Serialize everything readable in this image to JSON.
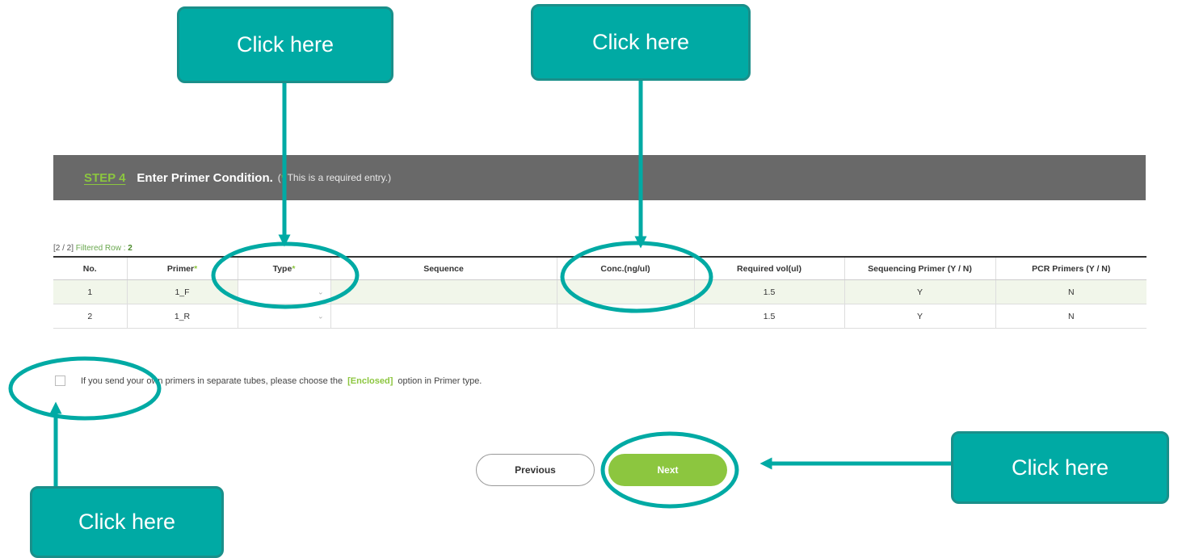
{
  "step": {
    "label": "STEP 4",
    "title": "Enter Primer Condition.",
    "note_star": "*",
    "note_text": " This is a required entry.)",
    "note_open": "("
  },
  "filter": {
    "range": "[2 / 2]",
    "label": " Filtered Row : ",
    "count": "2"
  },
  "table": {
    "headers": {
      "no": "No.",
      "primer": "Primer",
      "type": "Type",
      "sequence": "Sequence",
      "conc": "Conc.(ng/ul)",
      "required_vol": "Required vol(ul)",
      "sequencing": "Sequencing Primer (Y / N)",
      "pcr": "PCR Primers (Y / N)"
    },
    "required_mark": "*",
    "rows": [
      {
        "no": "1",
        "primer": "1_F",
        "type": "",
        "sequence": "",
        "conc": "",
        "required_vol": "1.5",
        "sequencing": "Y",
        "pcr": "N"
      },
      {
        "no": "2",
        "primer": "1_R",
        "type": "",
        "sequence": "",
        "conc": "",
        "required_vol": "1.5",
        "sequencing": "Y",
        "pcr": "N"
      }
    ]
  },
  "checkbox": {
    "text_before": "If you send your own primers in separate tubes, please choose the ",
    "highlight": "[Enclosed]",
    "text_after": " option in Primer type.",
    "checked": false
  },
  "buttons": {
    "previous": "Previous",
    "next": "Next"
  },
  "callouts": {
    "type_column": "Click here",
    "conc_column": "Click here",
    "next_button": "Click here",
    "checkbox": "Click here"
  },
  "colors": {
    "accent_green": "#8cc63f",
    "callout_teal": "#00aaa4",
    "header_bar": "#696969"
  }
}
